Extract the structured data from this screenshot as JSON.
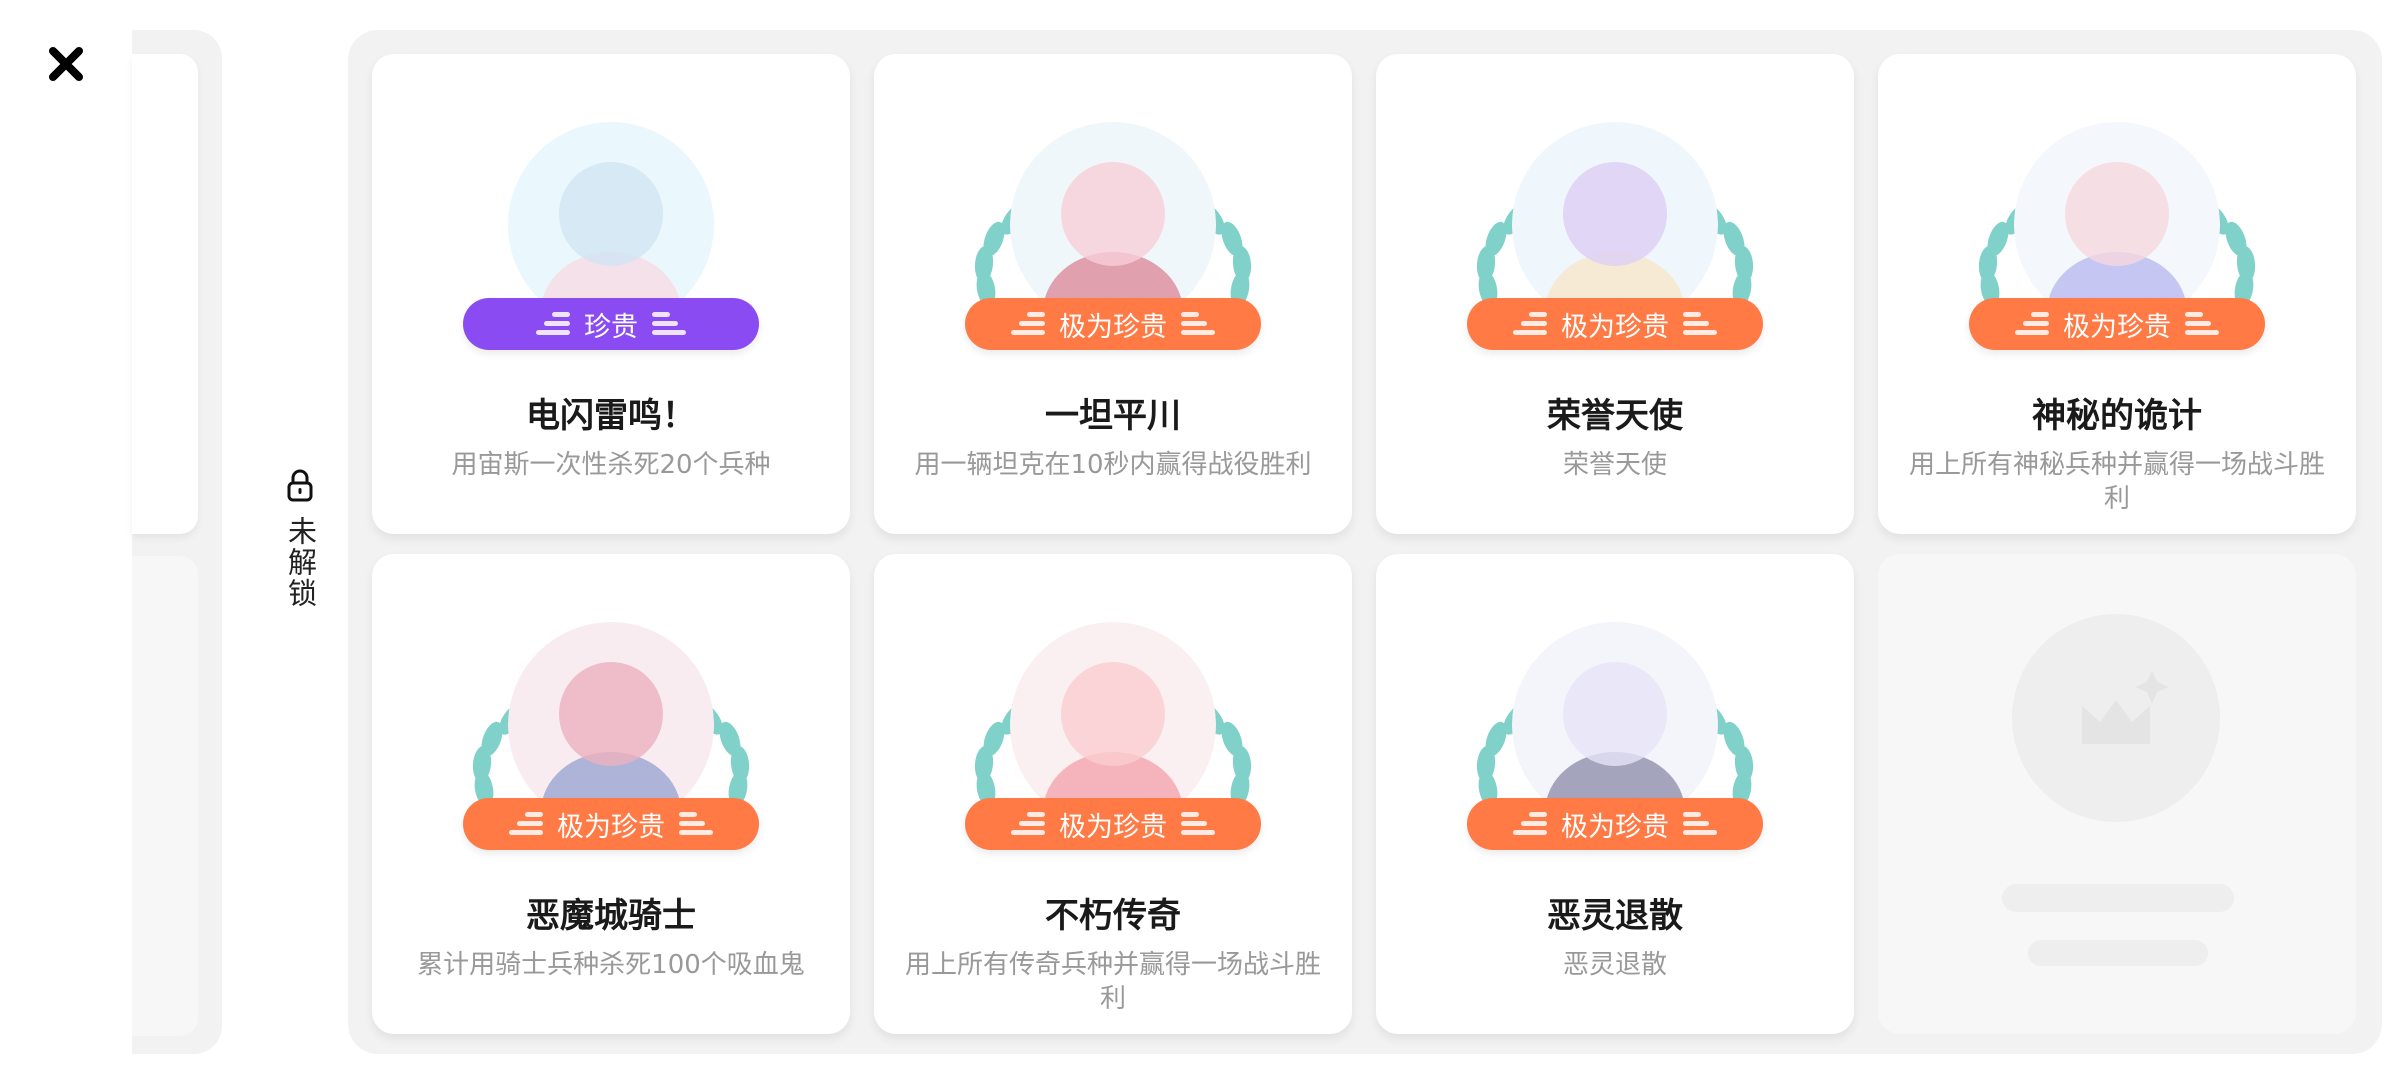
{
  "sidebar": {
    "locked_label": "未解锁"
  },
  "colors": {
    "rare_tag": "#8a4cf2",
    "very_rare_tag": "#ff7a45",
    "wreath": "#7fd1c9",
    "panel_bg": "#f2f2f2"
  },
  "icons": {
    "close": "close-icon",
    "lock": "lock-icon",
    "placeholder": "crown-sparkle-icon"
  },
  "achievements": [
    {
      "title": "电闪雷鸣！",
      "description": "用宙斯一次性杀死20个兵种",
      "rarity": "珍贵",
      "rarity_level": "rare",
      "avatar": "zeus-character"
    },
    {
      "title": "一坦平川",
      "description": "用一辆坦克在10秒内赢得战役胜利",
      "rarity": "极为珍贵",
      "rarity_level": "very-rare",
      "avatar": "tank-duo-character"
    },
    {
      "title": "荣誉天使",
      "description": "荣誉天使",
      "rarity": "极为珍贵",
      "rarity_level": "very-rare",
      "avatar": "winged-angel-character"
    },
    {
      "title": "神秘的诡计",
      "description": "用上所有神秘兵种并赢得一场战斗胜利",
      "rarity": "极为珍贵",
      "rarity_level": "very-rare",
      "avatar": "mystic-spear-character"
    },
    {
      "title": "恶魔城骑士",
      "description": "累计用骑士兵种杀死100个吸血鬼",
      "rarity": "极为珍贵",
      "rarity_level": "very-rare",
      "avatar": "knight-shield-character"
    },
    {
      "title": "不朽传奇",
      "description": "用上所有传奇兵种并赢得一场战斗胜利",
      "rarity": "极为珍贵",
      "rarity_level": "very-rare",
      "avatar": "boxer-character"
    },
    {
      "title": "恶灵退散",
      "description": "恶灵退散",
      "rarity": "极为珍贵",
      "rarity_level": "very-rare",
      "avatar": "ghost-reaper-character"
    }
  ]
}
